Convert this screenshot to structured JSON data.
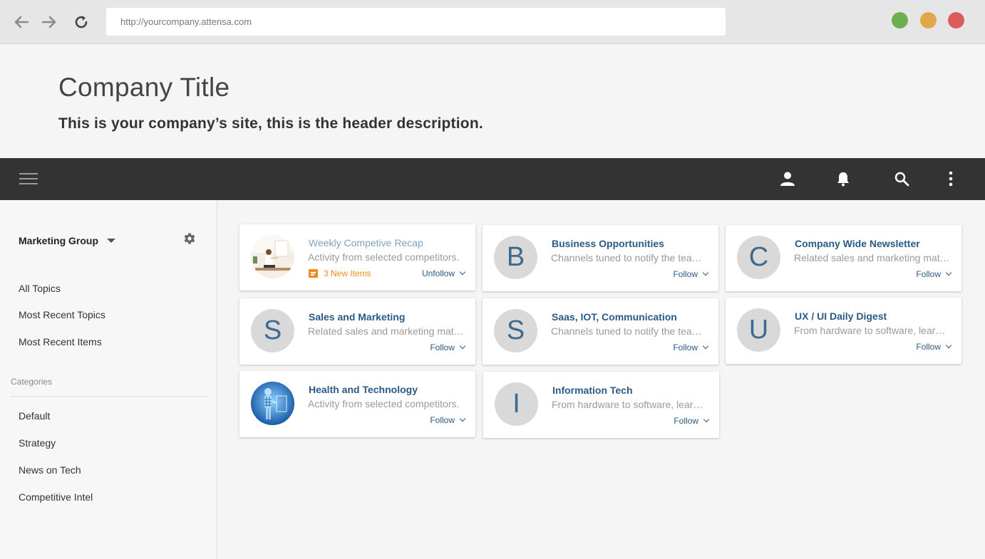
{
  "browser": {
    "url": "http://yourcompany.attensa.com",
    "dots": [
      "#6ab04c",
      "#e0a84a",
      "#dc5c5c"
    ]
  },
  "header": {
    "title": "Company Title",
    "description": "This is your company’s site, this is the header description."
  },
  "toolbar": {
    "icons": [
      "menu-icon",
      "user-icon",
      "bell-icon",
      "search-icon",
      "more-vertical-icon"
    ]
  },
  "sidebar": {
    "group": "Marketing Group",
    "links": [
      "All Topics",
      "Most Recent Topics",
      "Most Recent Items"
    ],
    "categories_heading": "Categories",
    "categories": [
      "Default",
      "Strategy",
      "News on Tech",
      "Competitive Intel"
    ]
  },
  "cards": [
    {
      "title": "Weekly Competive Recap",
      "desc": "Activity from selected competitors.",
      "action": "Unfollow",
      "badge": "3 New Items",
      "avatar": "image-office"
    },
    {
      "title": "Business Opportunities",
      "desc": "Channels tuned to notify the team of opportunities",
      "action": "Follow",
      "letter": "B"
    },
    {
      "title": "Company Wide Newsletter",
      "desc": "Related sales and marketing material for teams",
      "action": "Follow",
      "letter": "C"
    },
    {
      "title": "Sales and Marketing",
      "desc": "Related sales and marketing material for teams",
      "action": "Follow",
      "letter": "S"
    },
    {
      "title": "Saas, IOT, Communication",
      "desc": "Channels tuned to notify the team of opportunities",
      "action": "Follow",
      "letter": "S"
    },
    {
      "title": "UX / UI Daily Digest",
      "desc": "From hardware to software, learn more daily",
      "action": "Follow",
      "letter": "U"
    },
    {
      "title": "Health and Technology",
      "desc": "Activity from selected competitors.",
      "action": "Follow",
      "avatar": "image-health"
    },
    {
      "title": "Information Tech",
      "desc": "From hardware to software, learn more daily",
      "action": "Follow",
      "letter": "I"
    }
  ],
  "colors": {
    "accent": "#2a5a86",
    "badge": "#f08c1b",
    "toolbar": "#333333"
  }
}
